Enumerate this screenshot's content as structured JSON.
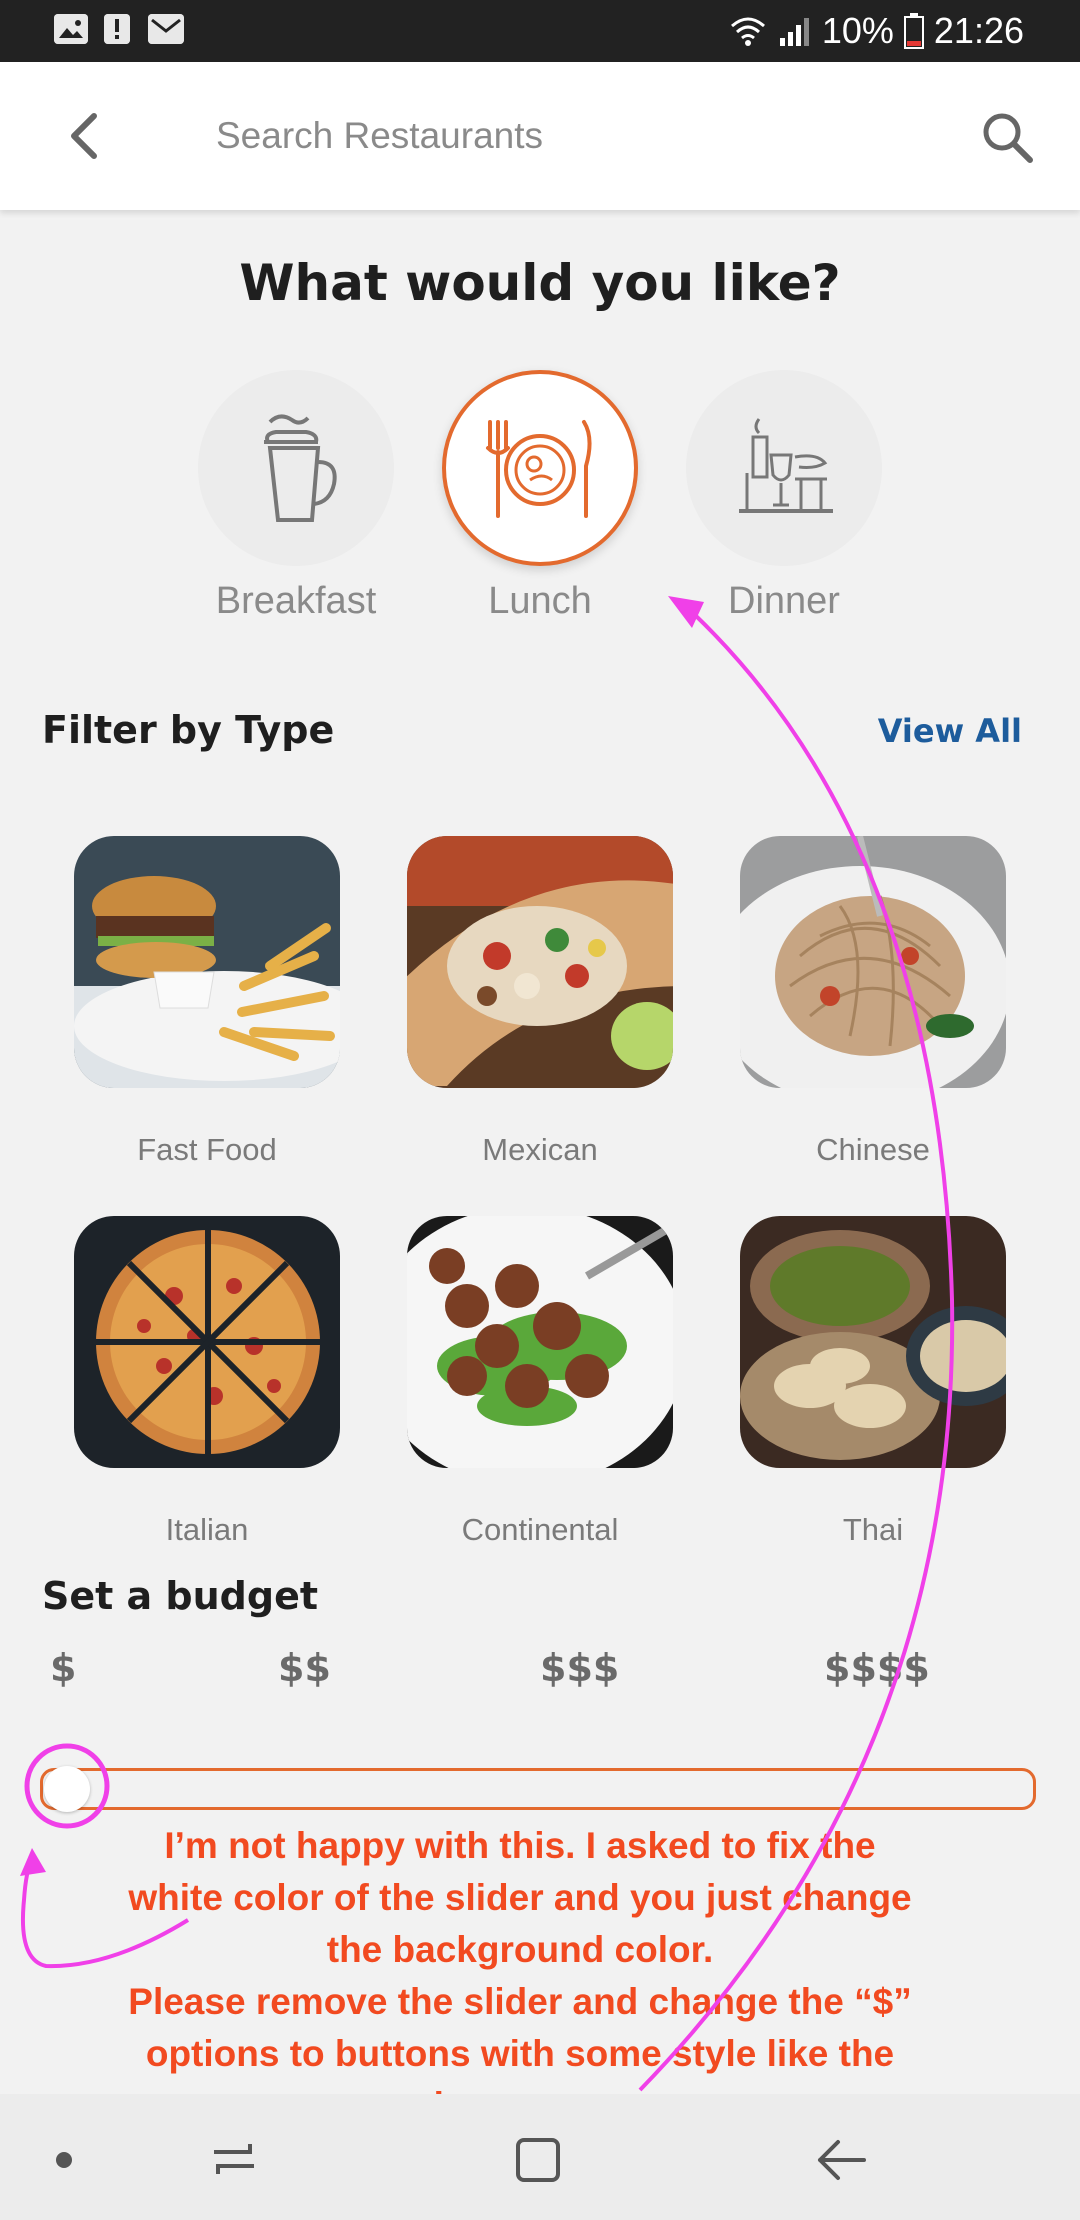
{
  "status_bar": {
    "battery": "10%",
    "time": "21:26"
  },
  "search": {
    "placeholder": "Search Restaurants"
  },
  "heading": "What would you like?",
  "meals": [
    {
      "label": "Breakfast",
      "icon": "coffee-cup-icon",
      "selected": false
    },
    {
      "label": "Lunch",
      "icon": "plate-cutlery-icon",
      "selected": true
    },
    {
      "label": "Dinner",
      "icon": "dinner-table-icon",
      "selected": false
    }
  ],
  "filter": {
    "title": "Filter by Type",
    "view_all": "View All",
    "types": [
      "Fast Food",
      "Mexican",
      "Chinese",
      "Italian",
      "Continental",
      "Thai"
    ]
  },
  "budget": {
    "title": "Set a budget",
    "options": [
      "$",
      "$$",
      "$$$",
      "$$$$"
    ],
    "slider_value": 0
  },
  "annotation": {
    "lines": [
      "I’m not happy with this. I asked to fix the",
      "white color of the slider and you just change",
      "the background color.",
      "Please remove the slider and change the “$”",
      "options to buttons with some style like the",
      "above ones."
    ]
  },
  "colors": {
    "accent": "#e36a2e",
    "link": "#1d5c9c",
    "annotation_text": "#f24a20",
    "annotation_stroke": "#f040e8"
  }
}
